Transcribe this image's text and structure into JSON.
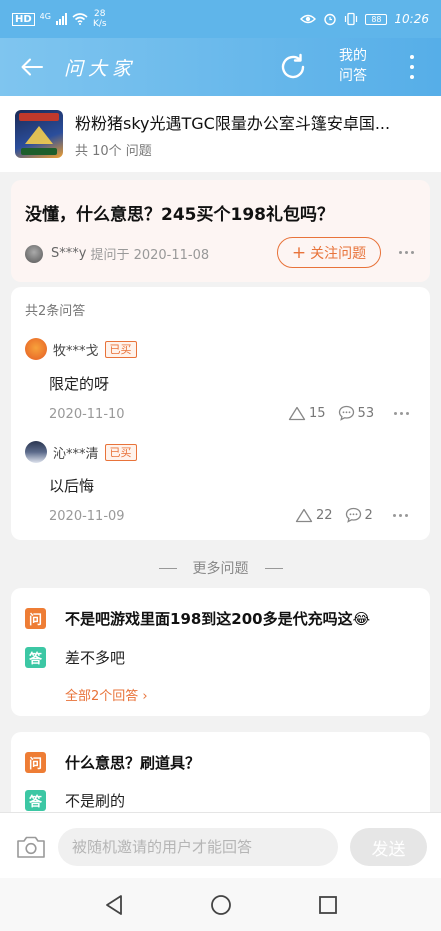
{
  "status_bar": {
    "hd_label": "HD",
    "network": "4G",
    "speed_value": "28",
    "speed_unit": "K/s",
    "battery_level": "88",
    "time": "10:26"
  },
  "header": {
    "title": "问大家",
    "my_answers_line1": "我的",
    "my_answers_line2": "问答",
    "background_color": "#5fb5ea"
  },
  "game": {
    "title": "粉粉猪sky光遇TGC限量办公室斗篷安卓国...",
    "question_count": "共 10个 问题"
  },
  "question": {
    "text": "没懂，什么意思？245买个198礼包吗？",
    "asker_name": "S***y",
    "asked_date": "提问于 2020-11-08",
    "follow_label": "关注问题",
    "follow_plus": "+",
    "accent_color": "#e8733a"
  },
  "answers": {
    "count_label": "共2条问答",
    "items": [
      {
        "user": "牧***戈",
        "badge": "已买",
        "text": "限定的呀",
        "date": "2020-11-10",
        "likes": "15",
        "comments": "53"
      },
      {
        "user": "沁***清",
        "badge": "已买",
        "text": "以后悔",
        "date": "2020-11-09",
        "likes": "22",
        "comments": "2"
      }
    ]
  },
  "more_questions": {
    "divider_label": "更多问题",
    "items": [
      {
        "q_tag": "问",
        "a_tag": "答",
        "question": "不是吧游戏里面198到这200多是代充吗这😂",
        "answer": "差不多吧",
        "all_answers": "全部2个回答"
      },
      {
        "q_tag": "问",
        "a_tag": "答",
        "question": "什么意思？刷道具？",
        "answer": "不是刷的"
      }
    ]
  },
  "input_bar": {
    "placeholder": "被随机邀请的用户才能回答",
    "send_label": "发送"
  }
}
